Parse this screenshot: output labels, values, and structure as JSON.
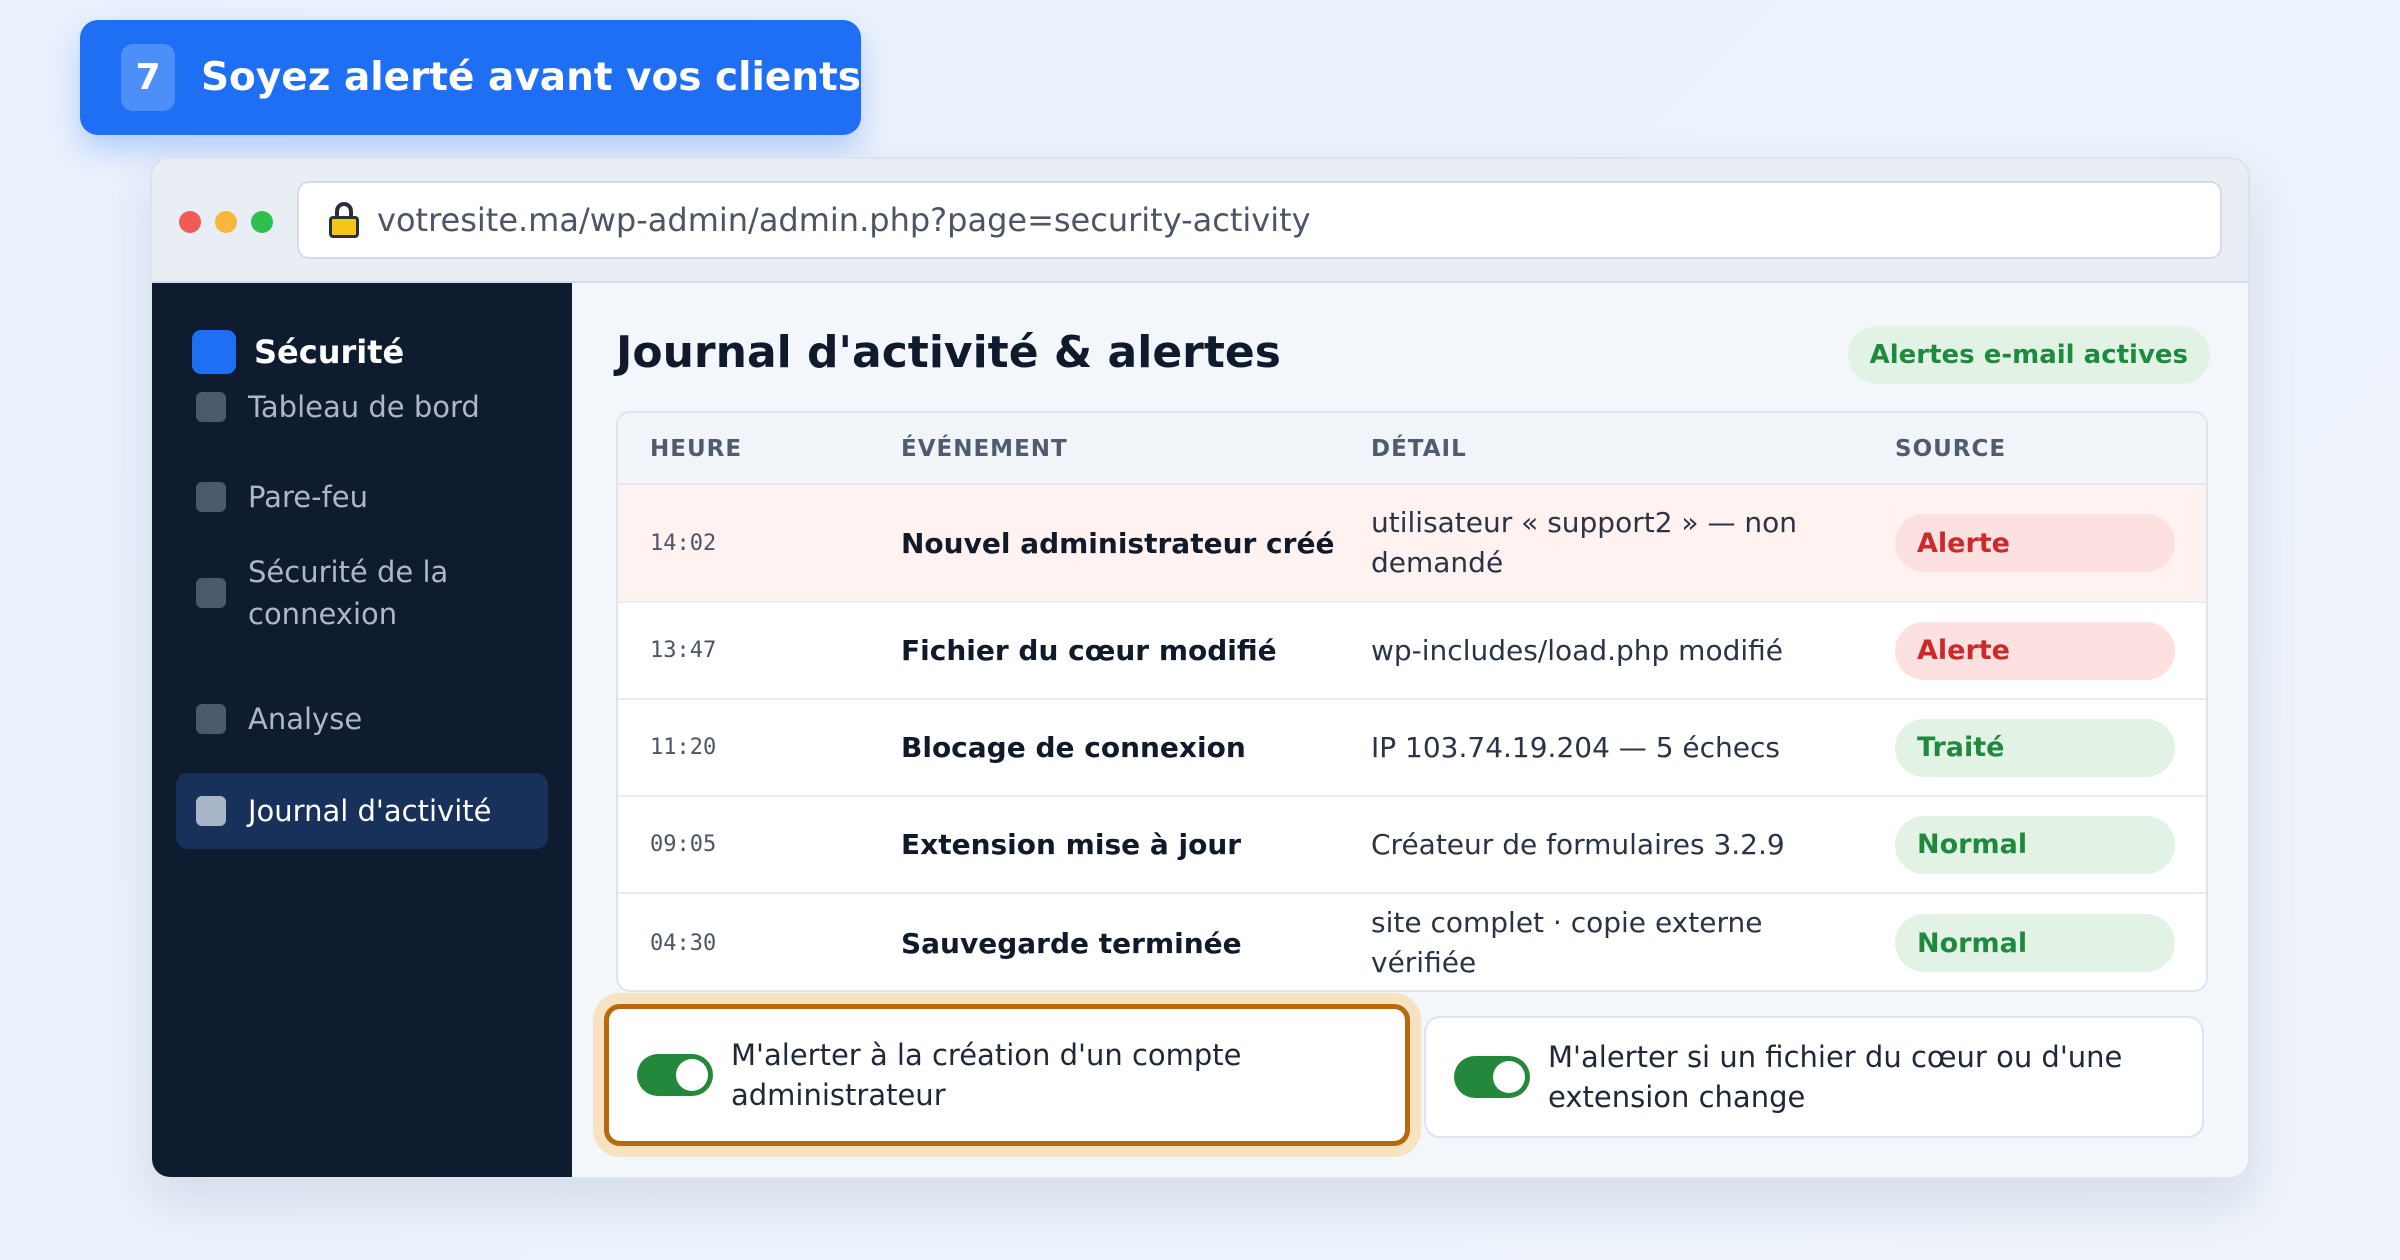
{
  "step": {
    "number": "7",
    "title": "Soyez alerté avant vos clients"
  },
  "browser": {
    "url": "votresite.ma/wp-admin/admin.php?page=security-activity"
  },
  "sidebar": {
    "brand": "Sécurité",
    "items": [
      {
        "label": "Tableau de bord"
      },
      {
        "label": "Pare-feu"
      },
      {
        "label": "Sécurité de la connexion"
      },
      {
        "label": "Analyse"
      },
      {
        "label": "Journal d'activité",
        "active": true
      }
    ]
  },
  "main": {
    "title": "Journal d'activité & alertes",
    "email_badge": "Alertes e-mail actives",
    "table": {
      "headers": [
        "HEURE",
        "ÉVÉNEMENT",
        "DÉTAIL",
        "SOURCE"
      ],
      "rows": [
        {
          "time": "14:02",
          "event": "Nouvel administrateur créé",
          "detail": "utilisateur « support2 » — non demandé",
          "source": "Alerte",
          "kind": "alert"
        },
        {
          "time": "13:47",
          "event": "Fichier du cœur modifié",
          "detail": "wp-includes/load.php modifié",
          "source": "Alerte",
          "kind": "alert"
        },
        {
          "time": "11:20",
          "event": "Blocage de connexion",
          "detail": "IP 103.74.19.204 — 5 échecs",
          "source": "Traité",
          "kind": "ok"
        },
        {
          "time": "09:05",
          "event": "Extension mise à jour",
          "detail": "Créateur de formulaires 3.2.9",
          "source": "Normal",
          "kind": "ok"
        },
        {
          "time": "04:30",
          "event": "Sauvegarde terminée",
          "detail": "site complet · copie externe vérifiée",
          "source": "Normal",
          "kind": "ok"
        }
      ]
    },
    "toggles": [
      {
        "label": "M'alerter à la création d'un compte administrateur",
        "on": true,
        "highlighted": true
      },
      {
        "label": "M'alerter si un fichier du cœur ou d'une extension change",
        "on": true,
        "highlighted": false
      }
    ]
  },
  "colors": {
    "accent": "#1f6ff5",
    "sidebar_bg": "#0f1b2e",
    "alert_red": "#cc2a2a",
    "ok_green": "#1f8a3e",
    "highlight_border": "#b8680e"
  }
}
